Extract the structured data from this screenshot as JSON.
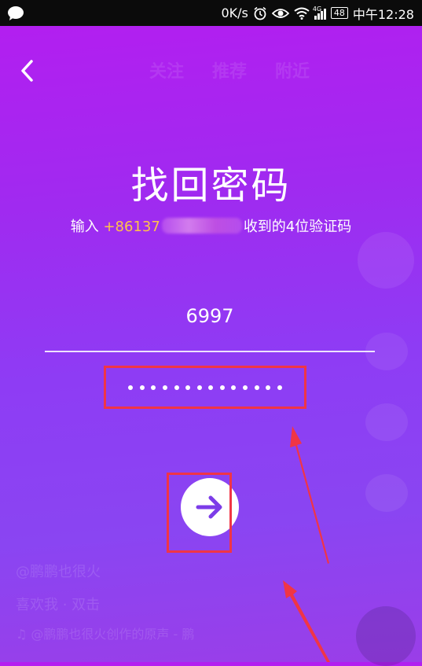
{
  "status_bar": {
    "network_speed": "0K/s",
    "network_type": "4G",
    "battery": "48",
    "time": "中午12:28"
  },
  "background_feed": {
    "tabs": [
      "关注",
      "推荐",
      "附近"
    ],
    "username": "@鹏鹏也很火",
    "caption": "喜欢我 · 双击",
    "music": "♫ @鹏鹏也很火创作的原声 - 鹏"
  },
  "header": {
    "back_icon": "chevron-left-icon",
    "title": "找回密码"
  },
  "subtitle": {
    "prefix": "输入 ",
    "phone": "+86137",
    "suffix": "收到的4位验证码"
  },
  "verification_code": {
    "value": "6997"
  },
  "password": {
    "masked_length": 14
  },
  "next_button": {
    "icon": "arrow-right-icon",
    "icon_color": "#7c3ce8"
  },
  "colors": {
    "gradient_top": "#b51df0",
    "gradient_bottom": "#8a45f2",
    "phone_highlight": "#ffc24a",
    "annotation_red": "#f03546"
  }
}
